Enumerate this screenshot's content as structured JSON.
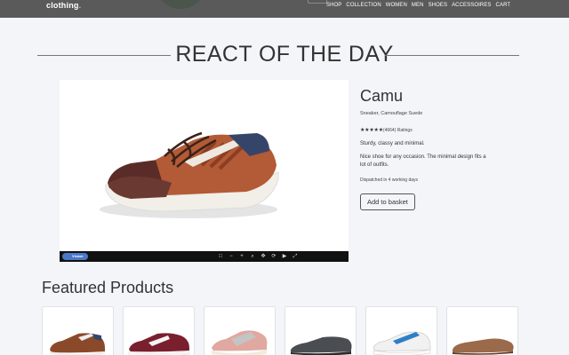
{
  "navbar": {
    "brand": "clothing",
    "brand_suffix": ".",
    "links": [
      "SHOP",
      "COLLECTION",
      "WOMEN",
      "MEN",
      "SHOES",
      "ACCESSOIRES",
      "CART"
    ]
  },
  "hero": {
    "title": "REACT OF THE DAY"
  },
  "product": {
    "name": "Camu",
    "subtitle": "Sneaker, Camouflage Suede",
    "stars": "★★★★★",
    "rating_text": "(4664) Ratings",
    "desc_short": "Sturdy, classy and minimal.",
    "desc_long": "Nice shoe for any occasion. The minimal design fits a lot of outfits.",
    "shipping": "Dispatched in 4 working days",
    "add_button": "Add to basket",
    "viewer_badge": "Viewer"
  },
  "featured": {
    "title": "Featured Products",
    "items": [
      {
        "icon": "brown-sneaker-icon",
        "color": "#8a4a2a"
      },
      {
        "icon": "burgundy-sneaker-icon",
        "color": "#7a1f2e"
      },
      {
        "icon": "pink-runner-icon",
        "color": "#e0a8a0"
      },
      {
        "icon": "grey-shoe-icon",
        "color": "#4a4d52"
      },
      {
        "icon": "white-blue-sneaker-icon",
        "color": "#2e7fc7"
      },
      {
        "icon": "tan-loafer-icon",
        "color": "#9a6a4a"
      }
    ]
  },
  "colors": {
    "navbar": "#5a5a5a",
    "background": "#f3f5f8",
    "viewer_bar": "#111111",
    "viewer_badge": "#4a78c8"
  }
}
